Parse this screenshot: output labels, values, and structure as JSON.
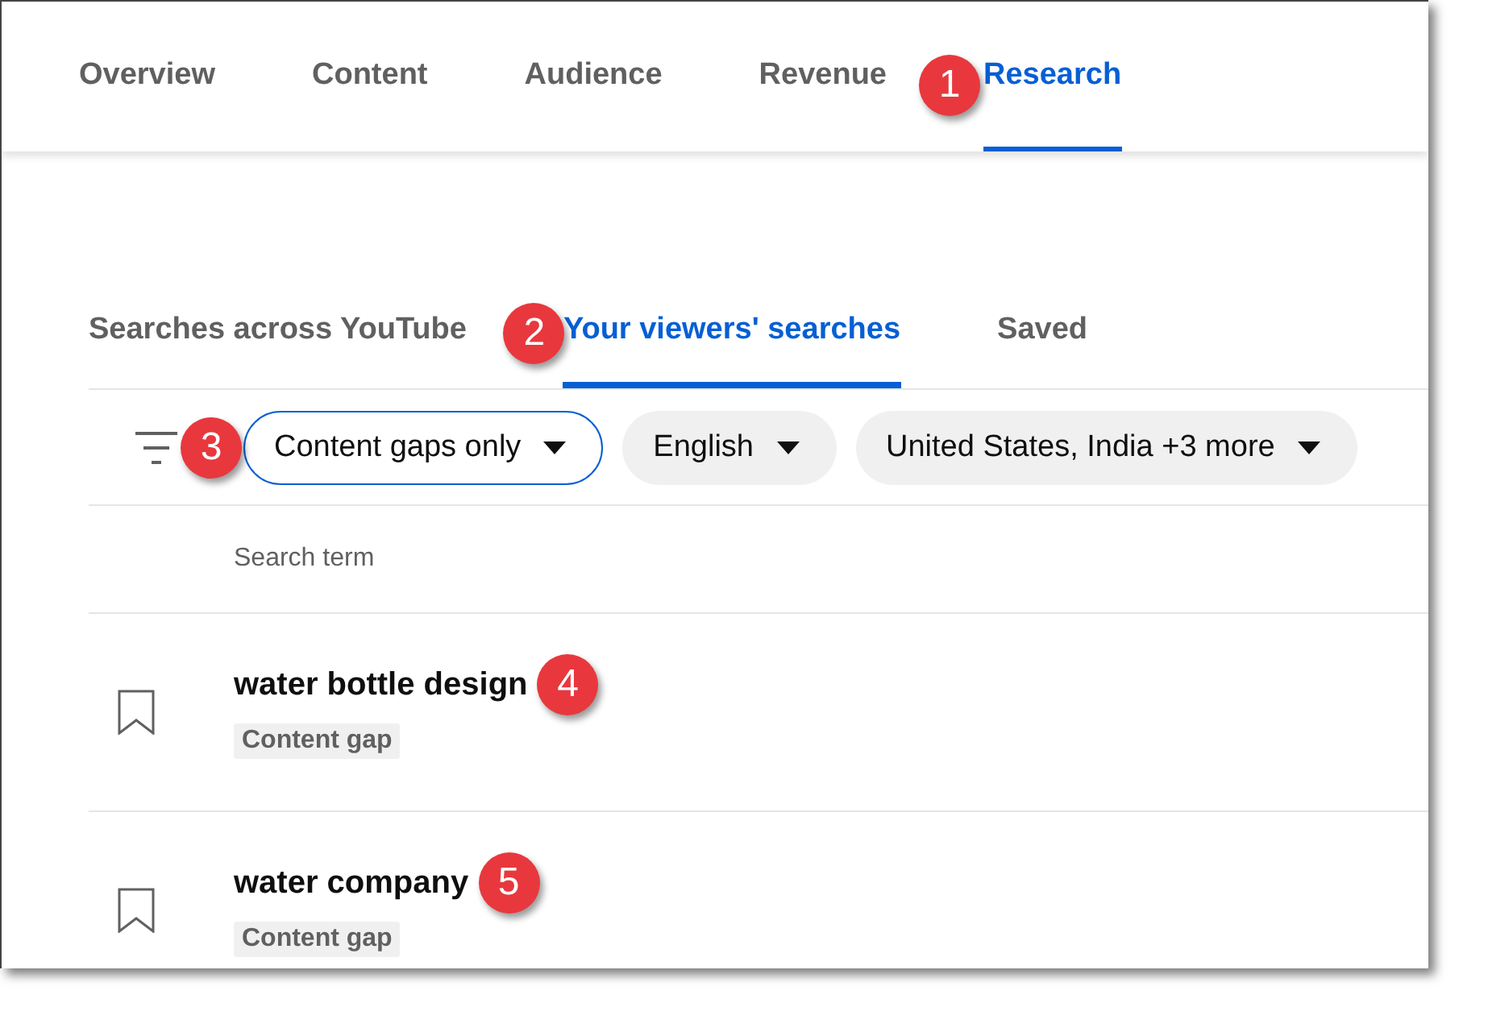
{
  "nav_tabs": [
    {
      "label": "Overview",
      "selected": false
    },
    {
      "label": "Content",
      "selected": false
    },
    {
      "label": "Audience",
      "selected": false
    },
    {
      "label": "Revenue",
      "selected": false
    },
    {
      "label": "Research",
      "selected": true,
      "callout": "1"
    }
  ],
  "sub_tabs": [
    {
      "label": "Searches across YouTube",
      "selected": false
    },
    {
      "label": "Your viewers' searches",
      "selected": true,
      "callout": "2"
    },
    {
      "label": "Saved",
      "selected": false
    }
  ],
  "filters": [
    {
      "label": "Content gaps only",
      "selected": true,
      "callout": "3"
    },
    {
      "label": "English",
      "selected": false
    },
    {
      "label": "United States, India +3 more",
      "selected": false
    }
  ],
  "table": {
    "columns": [
      "Search term"
    ],
    "rows": [
      {
        "term": "water bottle design",
        "tag": "Content gap",
        "saved": false,
        "callout": "4"
      },
      {
        "term": "water company",
        "tag": "Content gap",
        "saved": false,
        "callout": "5"
      }
    ]
  }
}
